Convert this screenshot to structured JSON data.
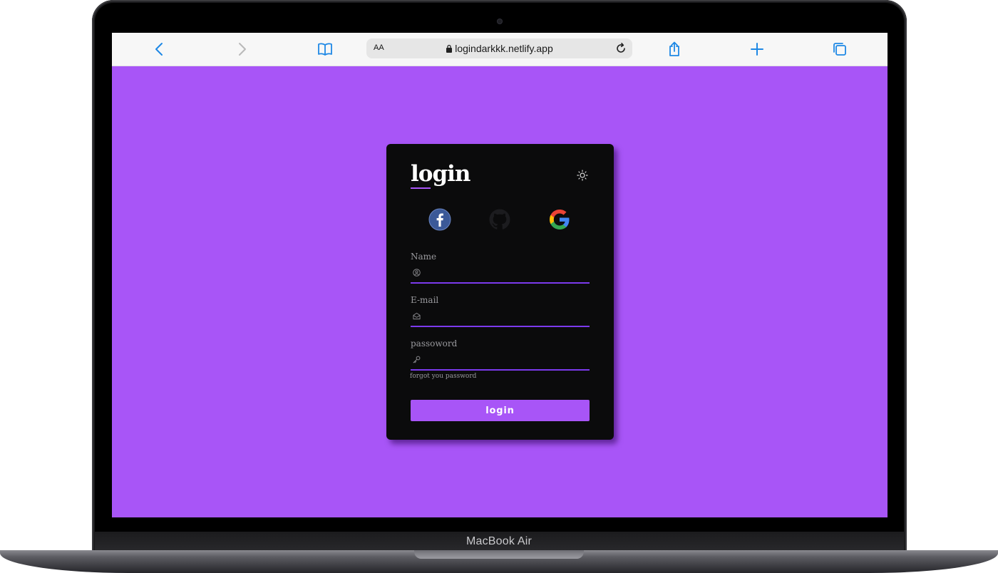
{
  "device": {
    "brand_label": "MacBook Air"
  },
  "browser": {
    "text_size_label": "AA",
    "url": "logindarkkk.netlify.app",
    "icons": [
      "back-icon",
      "forward-icon",
      "bookmarks-icon",
      "lock-icon",
      "reload-icon",
      "share-icon",
      "new-tab-icon",
      "tabs-icon"
    ]
  },
  "page": {
    "background_color": "#a855f7",
    "card": {
      "title": "login",
      "theme_icon": "sun-icon",
      "social": [
        {
          "icon": "facebook-icon"
        },
        {
          "icon": "github-icon"
        },
        {
          "icon": "google-icon"
        }
      ],
      "fields": {
        "name": {
          "label": "Name",
          "icon": "user-icon",
          "value": ""
        },
        "email": {
          "label": "E-mail",
          "icon": "envelope-icon",
          "value": ""
        },
        "password": {
          "label": "passoword",
          "icon": "key-icon",
          "value": ""
        }
      },
      "forgot_link": "forgot you password",
      "submit_label": "login"
    }
  },
  "colors": {
    "accent": "#a855f7",
    "underline": "#7c3aed",
    "card_bg": "#0b0b0c",
    "browser_blue": "#1e88e5"
  }
}
